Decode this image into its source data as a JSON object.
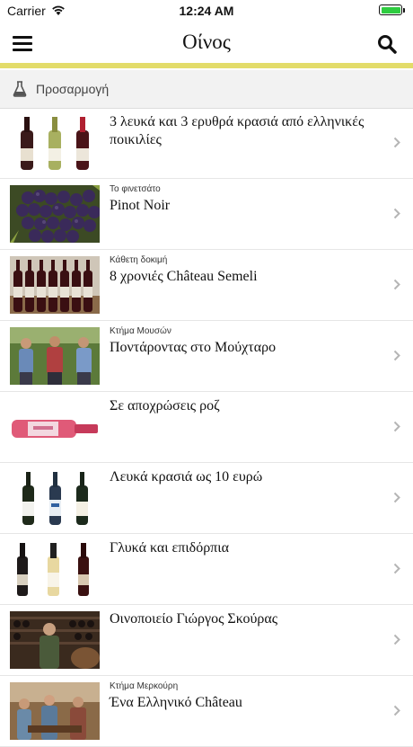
{
  "status": {
    "carrier": "Carrier",
    "time": "12:24 AM"
  },
  "nav": {
    "title": "Οίνος",
    "menu_icon": "hamburger-menu-icon",
    "search_icon": "search-icon"
  },
  "accent_color": "#e3dc6a",
  "filter": {
    "label": "Προσαρμογή",
    "icon": "flask-icon"
  },
  "items": [
    {
      "kicker": "",
      "title": "3 λευκά και 3 ερυθρά κρασιά από ελληνικές ποικιλίες",
      "thumb": "three-bottles"
    },
    {
      "kicker": "Το φινετσάτο",
      "title": "Pinot Noir",
      "thumb": "grapes"
    },
    {
      "kicker": "Κάθετη δοκιμή",
      "title": "8 χρονιές Château Semeli",
      "thumb": "many-bottles"
    },
    {
      "kicker": "Κτήμα Μουσών",
      "title": "Ποντάροντας στο Μούχταρο",
      "thumb": "people-vineyard"
    },
    {
      "kicker": "",
      "title": "Σε αποχρώσεις ροζ",
      "thumb": "rose-bottle"
    },
    {
      "kicker": "",
      "title": "Λευκά κρασιά ως 10 ευρώ",
      "thumb": "three-white-bottles"
    },
    {
      "kicker": "",
      "title": "Γλυκά και επιδόρπια",
      "thumb": "sweet-bottles"
    },
    {
      "kicker": "",
      "title": "Οινοποιείο Γιώργος Σκούρας",
      "thumb": "cellar-man"
    },
    {
      "kicker": "Κτήμα Μερκούρη",
      "title": "Ένα Ελληνικό Château",
      "thumb": "tasting-people"
    }
  ]
}
